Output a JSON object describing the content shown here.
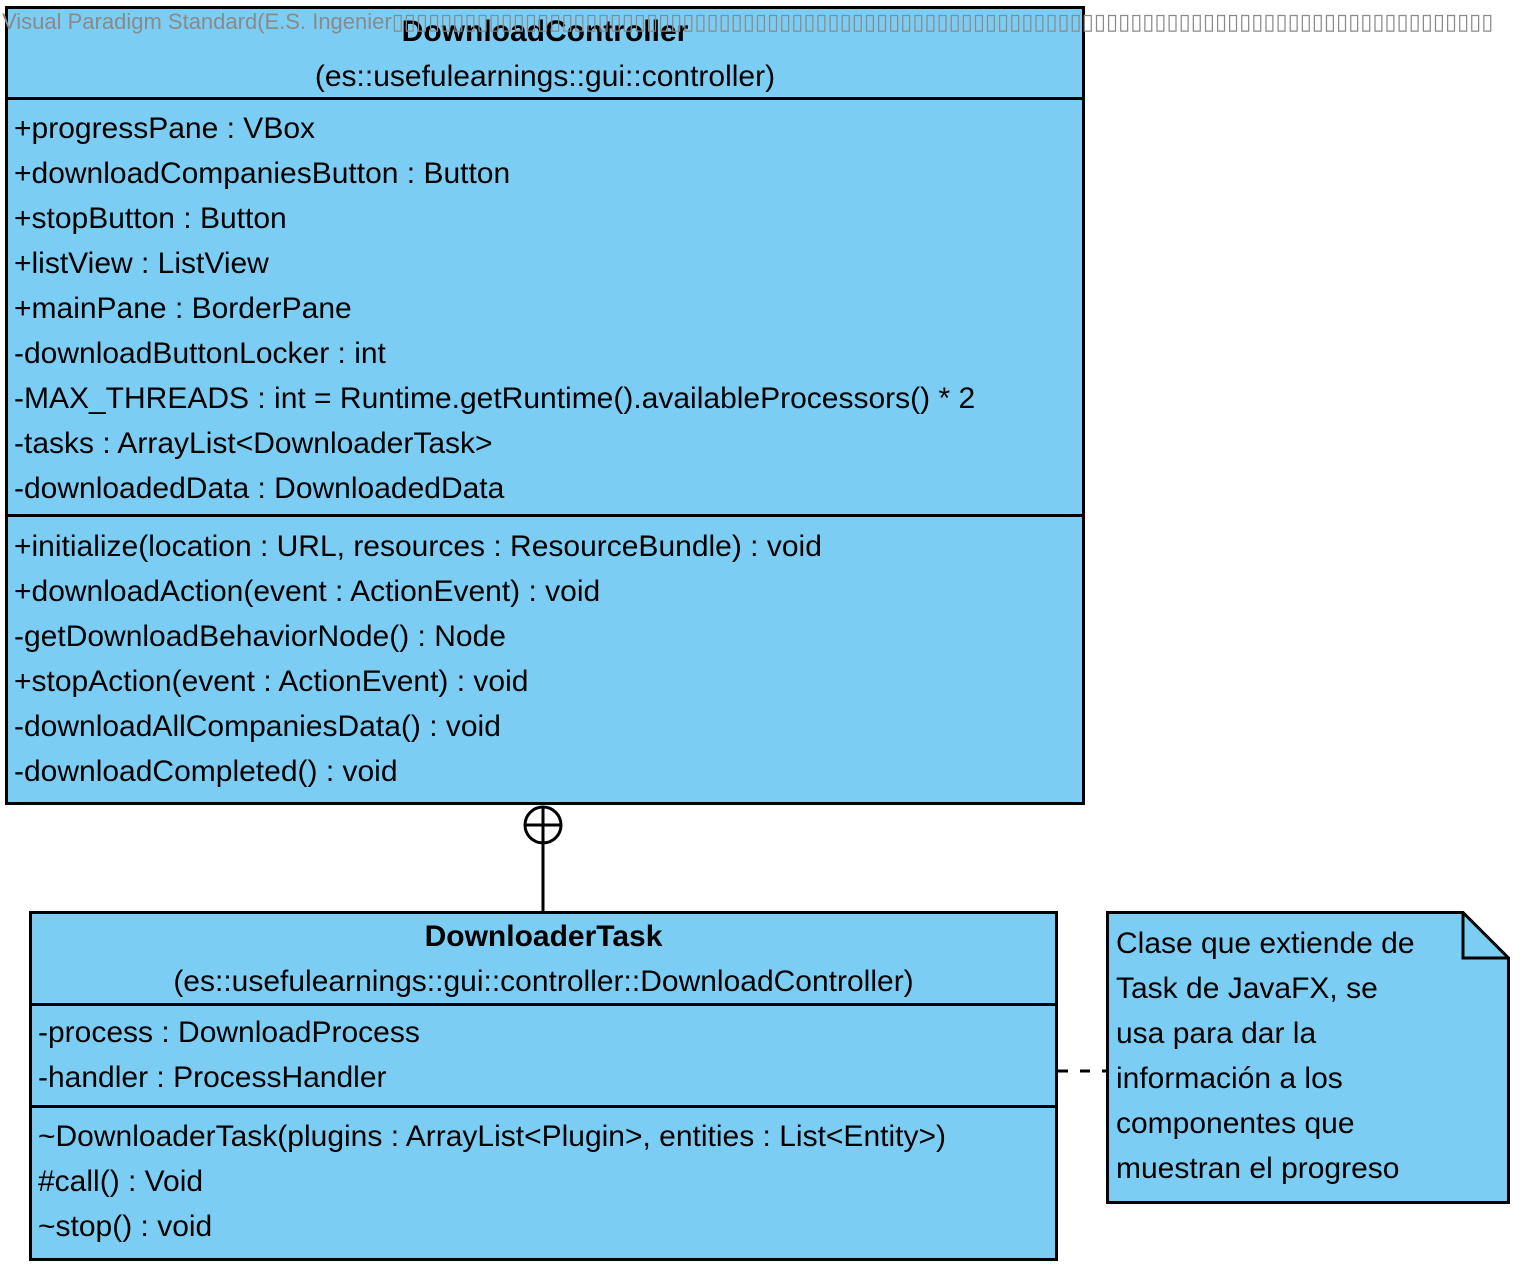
{
  "watermark": "Visual Paradigm Standard(E.S. Ingenier▯▯▯▯▯▯▯▯▯▯▯▯▯▯▯▯▯▯▯▯▯▯▯▯▯▯▯▯▯▯▯▯▯▯▯▯▯▯▯▯▯▯▯▯▯▯▯▯▯▯▯▯▯▯▯▯▯▯▯▯▯▯▯▯▯▯▯▯▯▯▯▯▯▯▯▯▯▯▯▯▯▯▯▯▯▯▯▯▯▯▯",
  "colors": {
    "class_fill": "#7ccdf4",
    "border": "#000000",
    "watermark": "#8a8a8a"
  },
  "download_controller": {
    "name": "DownloadController",
    "package": "(es::usefulearnings::gui::controller)",
    "attributes": [
      "+progressPane : VBox",
      "+downloadCompaniesButton : Button",
      "+stopButton : Button",
      "+listView : ListView",
      "+mainPane : BorderPane",
      "-downloadButtonLocker : int",
      "-MAX_THREADS : int = Runtime.getRuntime().availableProcessors() * 2",
      "-tasks : ArrayList<DownloaderTask>",
      "-downloadedData : DownloadedData"
    ],
    "operations": [
      "+initialize(location : URL, resources : ResourceBundle) : void",
      "+downloadAction(event : ActionEvent) : void",
      "-getDownloadBehaviorNode() : Node",
      "+stopAction(event : ActionEvent) : void",
      "-downloadAllCompaniesData() : void",
      "-downloadCompleted() : void"
    ]
  },
  "downloader_task": {
    "name": "DownloaderTask",
    "package": "(es::usefulearnings::gui::controller::DownloadController)",
    "attributes": [
      "-process : DownloadProcess",
      "-handler : ProcessHandler"
    ],
    "operations": [
      "~DownloaderTask(plugins : ArrayList<Plugin>, entities : List<Entity>)",
      "#call() : Void",
      "~stop() : void"
    ]
  },
  "note": {
    "lines": [
      "Clase que extiende de",
      "Task de JavaFX, se",
      "usa para dar la",
      "información a los",
      "componentes que",
      "muestran el progreso"
    ]
  }
}
